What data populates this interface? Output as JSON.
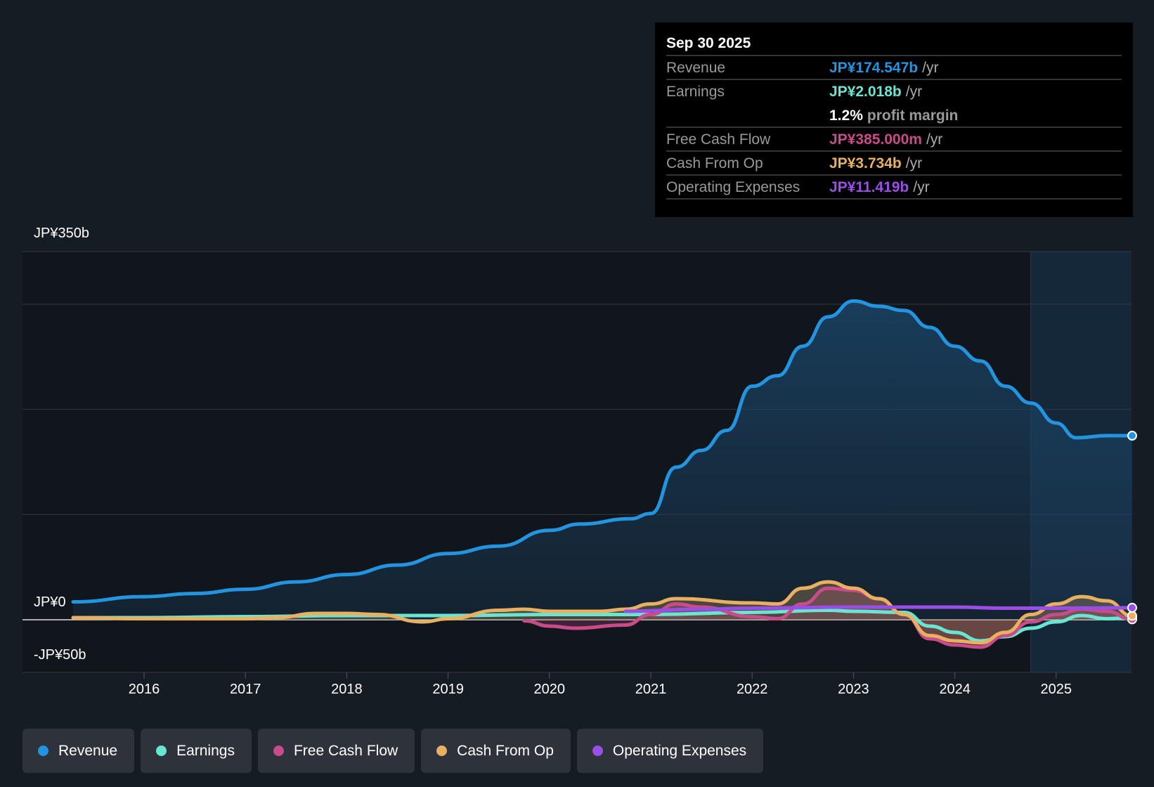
{
  "tooltip": {
    "date": "Sep 30 2025",
    "unit": "/yr",
    "rows": [
      {
        "label": "Revenue",
        "value": "JP¥174.547b",
        "color": "#2394df"
      },
      {
        "label": "Earnings",
        "value": "JP¥2.018b",
        "color": "#6ae5d1"
      },
      {
        "label": "Free Cash Flow",
        "value": "JP¥385.000m",
        "color": "#c84b8a"
      },
      {
        "label": "Cash From Op",
        "value": "JP¥3.734b",
        "color": "#e8b060"
      },
      {
        "label": "Operating Expenses",
        "value": "JP¥11.419b",
        "color": "#9a4ee6"
      }
    ],
    "margin_value": "1.2%",
    "margin_label": "profit margin"
  },
  "chart_data": {
    "type": "line",
    "ylabels": {
      "top": "JP¥350b",
      "zero": "JP¥0",
      "bottom": "-JP¥50b"
    },
    "ylim": [
      -50,
      350
    ],
    "xlim": [
      2015.0,
      2025.75
    ],
    "xticks": [
      "2016",
      "2017",
      "2018",
      "2019",
      "2020",
      "2021",
      "2022",
      "2023",
      "2024",
      "2025"
    ],
    "gridlines": [
      350,
      300,
      200,
      100,
      0,
      -50
    ],
    "highlight_from": 2024.75,
    "series": [
      {
        "name": "Revenue",
        "color": "#2394df",
        "fill": true,
        "points": [
          [
            2015.3,
            17
          ],
          [
            2016,
            22
          ],
          [
            2016.5,
            25
          ],
          [
            2017,
            29
          ],
          [
            2017.5,
            36
          ],
          [
            2018,
            43
          ],
          [
            2018.5,
            52
          ],
          [
            2019,
            63
          ],
          [
            2019.5,
            70
          ],
          [
            2020,
            85
          ],
          [
            2020.3,
            91
          ],
          [
            2020.8,
            96
          ],
          [
            2021,
            101
          ],
          [
            2021.25,
            145
          ],
          [
            2021.5,
            161
          ],
          [
            2021.75,
            180
          ],
          [
            2022,
            222
          ],
          [
            2022.25,
            232
          ],
          [
            2022.5,
            260
          ],
          [
            2022.75,
            288
          ],
          [
            2023,
            303
          ],
          [
            2023.25,
            298
          ],
          [
            2023.5,
            294
          ],
          [
            2023.75,
            278
          ],
          [
            2024,
            260
          ],
          [
            2024.25,
            246
          ],
          [
            2024.5,
            222
          ],
          [
            2024.75,
            206
          ],
          [
            2025,
            187
          ],
          [
            2025.2,
            173
          ],
          [
            2025.5,
            175
          ],
          [
            2025.75,
            175
          ]
        ]
      },
      {
        "name": "Earnings",
        "color": "#6ae5d1",
        "points": [
          [
            2015.3,
            2
          ],
          [
            2016,
            2
          ],
          [
            2017,
            3
          ],
          [
            2018,
            4
          ],
          [
            2019,
            4
          ],
          [
            2020,
            5
          ],
          [
            2021,
            5
          ],
          [
            2022,
            7
          ],
          [
            2022.75,
            9
          ],
          [
            2023,
            8
          ],
          [
            2023.5,
            7
          ],
          [
            2023.75,
            -6
          ],
          [
            2024,
            -12
          ],
          [
            2024.25,
            -20
          ],
          [
            2024.5,
            -16
          ],
          [
            2024.75,
            -8
          ],
          [
            2025,
            -2
          ],
          [
            2025.25,
            4
          ],
          [
            2025.5,
            1
          ],
          [
            2025.75,
            2
          ]
        ]
      },
      {
        "name": "Free Cash Flow",
        "color": "#c84b8a",
        "fill": true,
        "points": [
          [
            2019.75,
            -1
          ],
          [
            2020,
            -6
          ],
          [
            2020.25,
            -8
          ],
          [
            2020.75,
            -5
          ],
          [
            2021,
            5
          ],
          [
            2021.25,
            15
          ],
          [
            2021.5,
            12
          ],
          [
            2022,
            3
          ],
          [
            2022.25,
            1
          ],
          [
            2022.5,
            15
          ],
          [
            2022.75,
            30
          ],
          [
            2023,
            28
          ],
          [
            2023.25,
            20
          ],
          [
            2023.5,
            5
          ],
          [
            2023.75,
            -18
          ],
          [
            2024,
            -24
          ],
          [
            2024.25,
            -26
          ],
          [
            2024.5,
            -15
          ],
          [
            2024.75,
            -2
          ],
          [
            2025,
            5
          ],
          [
            2025.25,
            10
          ],
          [
            2025.5,
            8
          ],
          [
            2025.75,
            0.4
          ]
        ]
      },
      {
        "name": "Cash From Op",
        "color": "#e8b060",
        "fill": true,
        "points": [
          [
            2015.3,
            2
          ],
          [
            2016,
            1
          ],
          [
            2017,
            1
          ],
          [
            2017.3,
            2
          ],
          [
            2017.7,
            6
          ],
          [
            2018,
            6
          ],
          [
            2018.3,
            5
          ],
          [
            2018.75,
            -2
          ],
          [
            2019,
            1
          ],
          [
            2019.5,
            9
          ],
          [
            2019.75,
            10
          ],
          [
            2020,
            8
          ],
          [
            2020.5,
            8
          ],
          [
            2020.75,
            10
          ],
          [
            2021,
            15
          ],
          [
            2021.25,
            20
          ],
          [
            2022,
            16
          ],
          [
            2022.25,
            15
          ],
          [
            2022.5,
            30
          ],
          [
            2022.75,
            36
          ],
          [
            2023,
            30
          ],
          [
            2023.25,
            20
          ],
          [
            2023.5,
            5
          ],
          [
            2023.75,
            -15
          ],
          [
            2024,
            -20
          ],
          [
            2024.25,
            -22
          ],
          [
            2024.5,
            -12
          ],
          [
            2024.75,
            5
          ],
          [
            2025,
            15
          ],
          [
            2025.25,
            22
          ],
          [
            2025.5,
            18
          ],
          [
            2025.75,
            3.7
          ]
        ]
      },
      {
        "name": "Operating Expenses",
        "color": "#9a4ee6",
        "points": [
          [
            2020.75,
            8
          ],
          [
            2021.5,
            10
          ],
          [
            2022,
            11
          ],
          [
            2023,
            12
          ],
          [
            2024,
            12
          ],
          [
            2024.5,
            11
          ],
          [
            2025,
            11
          ],
          [
            2025.75,
            11.4
          ]
        ]
      }
    ]
  },
  "legend": [
    {
      "label": "Revenue",
      "color": "#2394df"
    },
    {
      "label": "Earnings",
      "color": "#6ae5d1"
    },
    {
      "label": "Free Cash Flow",
      "color": "#c84b8a"
    },
    {
      "label": "Cash From Op",
      "color": "#e8b060"
    },
    {
      "label": "Operating Expenses",
      "color": "#9a4ee6"
    }
  ]
}
